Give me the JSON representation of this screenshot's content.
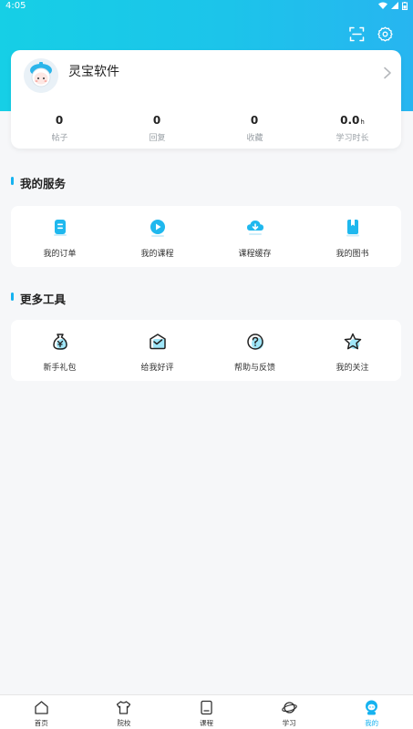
{
  "status_bar": {
    "time": "4:05"
  },
  "profile": {
    "name": "灵宝软件",
    "stats": [
      {
        "value": "0",
        "unit": "",
        "label": "帖子"
      },
      {
        "value": "0",
        "unit": "",
        "label": "回复"
      },
      {
        "value": "0",
        "unit": "",
        "label": "收藏"
      },
      {
        "value": "0.0",
        "unit": "h",
        "label": "学习时长"
      }
    ]
  },
  "services": {
    "title": "我的服务",
    "items": [
      {
        "label": "我的订单",
        "icon": "order-icon"
      },
      {
        "label": "我的课程",
        "icon": "play-course-icon"
      },
      {
        "label": "课程缓存",
        "icon": "download-cache-icon"
      },
      {
        "label": "我的图书",
        "icon": "book-icon"
      }
    ]
  },
  "tools": {
    "title": "更多工具",
    "items": [
      {
        "label": "新手礼包",
        "icon": "money-bag-icon"
      },
      {
        "label": "给我好评",
        "icon": "mail-review-icon"
      },
      {
        "label": "帮助与反馈",
        "icon": "help-question-icon"
      },
      {
        "label": "我的关注",
        "icon": "star-icon"
      }
    ]
  },
  "tabbar": {
    "items": [
      {
        "label": "首页",
        "icon": "home-icon",
        "active": false
      },
      {
        "label": "院校",
        "icon": "school-shirt-icon",
        "active": false
      },
      {
        "label": "课程",
        "icon": "course-page-icon",
        "active": false
      },
      {
        "label": "学习",
        "icon": "planet-study-icon",
        "active": false
      },
      {
        "label": "我的",
        "icon": "profile-astronaut-icon",
        "active": true
      }
    ]
  },
  "colors": {
    "accent": "#16b3f0",
    "header_gradient_start": "#16cfe6",
    "header_gradient_end": "#27b5f0"
  }
}
